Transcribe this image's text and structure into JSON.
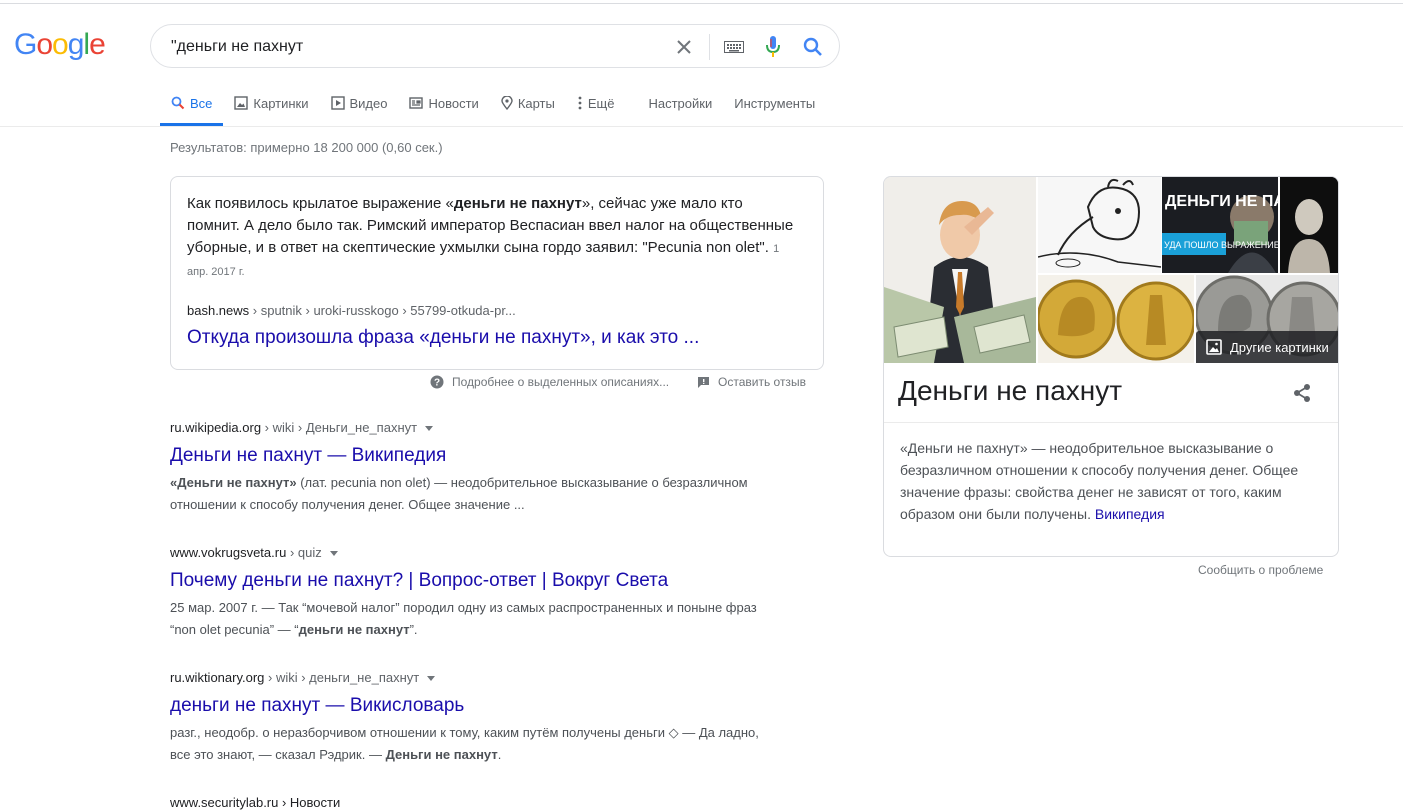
{
  "logo": {
    "letters": [
      "G",
      "o",
      "o",
      "g",
      "l",
      "e"
    ],
    "colors": [
      "#4285f4",
      "#ea4335",
      "#fbbc05",
      "#4285f4",
      "#34a853",
      "#ea4335"
    ]
  },
  "search": {
    "value": "\"деньги не пахнут"
  },
  "tabs": [
    {
      "label": "Все",
      "icon": "search-icon"
    },
    {
      "label": "Картинки",
      "icon": "image-icon"
    },
    {
      "label": "Видео",
      "icon": "video-icon"
    },
    {
      "label": "Новости",
      "icon": "news-icon"
    },
    {
      "label": "Карты",
      "icon": "map-pin-icon"
    },
    {
      "label": "Ещё",
      "icon": "more-vert-icon"
    },
    {
      "label": "Настройки"
    },
    {
      "label": "Инструменты"
    }
  ],
  "stats": "Результатов: примерно 18 200 000 (0,60 сек.)",
  "featured": {
    "text_before": "Как появилось крылатое выражение «",
    "text_bold": "деньги не пахнут",
    "text_after": "», сейчас уже мало кто помнит. А дело было так. Римский император Веспасиан ввел налог на общественные уборные, и в ответ на скептические ухмылки сына гордо заявил: \"Pecunia non olet\".",
    "date": "1 апр. 2017 г.",
    "domain": "bash.news",
    "path": " › sputnik › uroki-russkogo › 55799-otkuda-pr...",
    "title": "Откуда произошла фраза «деньги не пахнут», и как это ..."
  },
  "feedback": {
    "about": "Подробнее о выделенных описаниях...",
    "leave": "Оставить отзыв"
  },
  "results": [
    {
      "domain": "ru.wikipedia.org",
      "path": " › wiki › Деньги_не_пахнут",
      "title": "Деньги не пахнут — Википедия",
      "d1": "",
      "d2": "«Деньги не пахнут»",
      "d3": " (лат. pecunia non olet) — неодобрительное высказывание о безразличном отношении к способу получения денег. Общее значение ...",
      "d4": "",
      "d5": ""
    },
    {
      "domain": "www.vokrugsveta.ru",
      "path": " › quiz",
      "title": "Почему деньги не пахнут? | Вопрос-ответ | Вокруг Света",
      "d1": "25 мар. 2007 г. — Так “мочевой налог” породил одну из самых распространенных и поныне фраз “non olet pecunia” — “",
      "d2": "деньги не пахнут",
      "d3": "”.",
      "d4": "",
      "d5": ""
    },
    {
      "domain": "ru.wiktionary.org",
      "path": " › wiki › деньги_не_пахнут",
      "title": "деньги не пахнут — Викисловарь",
      "d1": "разг., неодобр. о неразборчивом отношении к тому, каким путём получены деньги ◇ — Да ладно, все это знают, — сказал Рэдрик. — ",
      "d2": "Деньги не пахнут",
      "d3": ".",
      "d4": "",
      "d5": ""
    }
  ],
  "cutoff_text": "www.securitylab.ru › Новости",
  "knowledge_panel": {
    "more_images": "Другие картинки",
    "title": "Деньги не пахнут",
    "description": "«Деньги не пахнут» — неодобрительное высказывание о безразличном отношении к способу получения денег. Общее значение фразы: свойства денег не зависят от того, каким образом они были получены.",
    "source": "Википедия",
    "thumb2_caption": "ДЕНЬГИ НЕ ПАХНУТ",
    "thumb2_sub": "УДА ПОШЛО ВЫРАЖЕНИЕ?"
  },
  "report": "Сообщить о проблеме"
}
